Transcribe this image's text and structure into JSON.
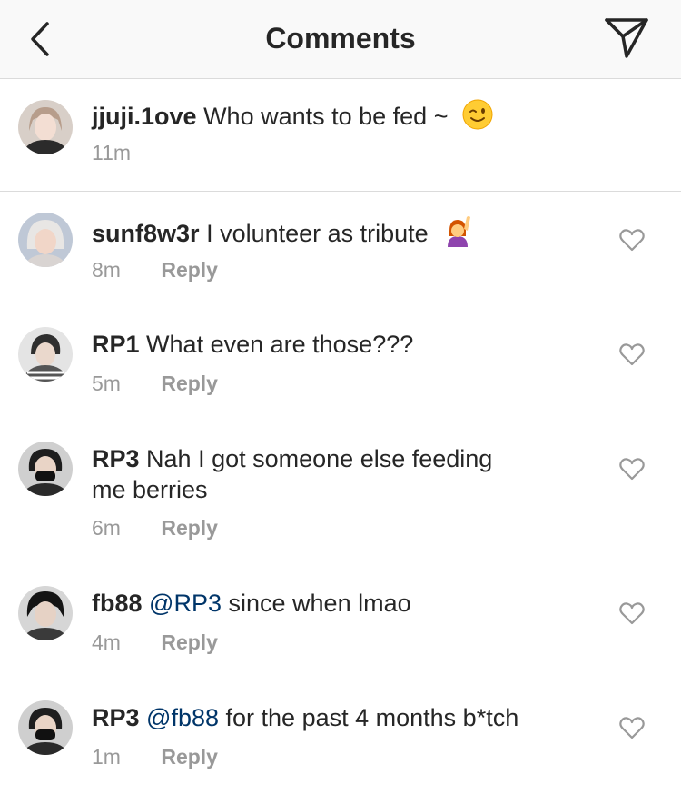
{
  "header": {
    "title": "Comments"
  },
  "caption": {
    "username": "jjuji.1ove",
    "text": "Who wants to be fed ~",
    "emoji": "wink-emoji",
    "time": "11m"
  },
  "comments": [
    {
      "username": "sunf8w3r",
      "mention": "",
      "text": "I volunteer as tribute",
      "emoji": "raising-hand-emoji",
      "time": "8m",
      "reply": "Reply"
    },
    {
      "username": "RP1",
      "mention": "",
      "text": "What even are those???",
      "time": "5m",
      "reply": "Reply"
    },
    {
      "username": "RP3",
      "mention": "",
      "text": "Nah I got someone else feeding",
      "text2": "me berries",
      "time": "6m",
      "reply": "Reply"
    },
    {
      "username": "fb88",
      "mention": "@RP3",
      "text": "since when lmao",
      "time": "4m",
      "reply": "Reply"
    },
    {
      "username": "RP3",
      "mention": "@fb88",
      "text": "for the past 4 months b*tch",
      "time": "1m",
      "reply": "Reply"
    }
  ],
  "icons": {
    "back": "chevron-left-icon",
    "send": "paper-plane-icon",
    "like": "heart-icon"
  },
  "colors": {
    "mention": "#003569",
    "secondary_text": "#999999",
    "divider": "#dbdbdb"
  }
}
